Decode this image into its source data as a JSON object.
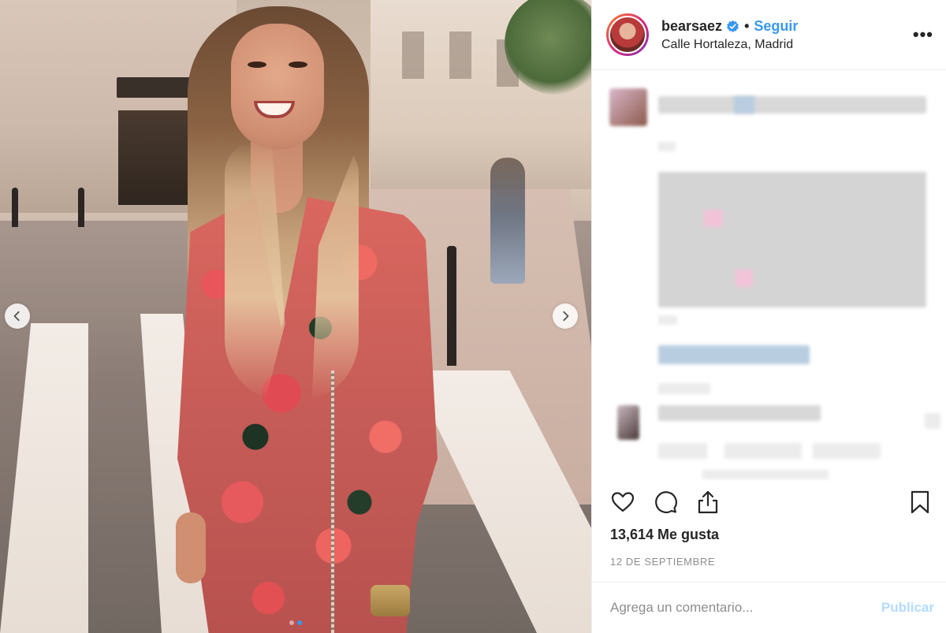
{
  "post": {
    "username": "bearsaez",
    "separator": "•",
    "follow_label": "Seguir",
    "location": "Calle Hortaleza, Madrid",
    "more_icon": "more-options-icon",
    "likes_text": "13,614 Me gusta",
    "date_text": "12 DE SEPTIEMBRE",
    "comment_placeholder": "Agrega un comentario...",
    "publish_label": "Publicar"
  },
  "carousel": {
    "slide_count": 2,
    "active_index": 1,
    "prev_icon": "chevron-left-icon",
    "next_icon": "chevron-right-icon"
  },
  "action_icons": [
    "heart-icon",
    "comment-icon",
    "share-icon",
    "bookmark-icon"
  ],
  "colors": {
    "link_blue": "#3897f0",
    "publish_disabled": "#b3dbff",
    "muted_text": "#8e8e8e",
    "divider": "#efefef"
  }
}
